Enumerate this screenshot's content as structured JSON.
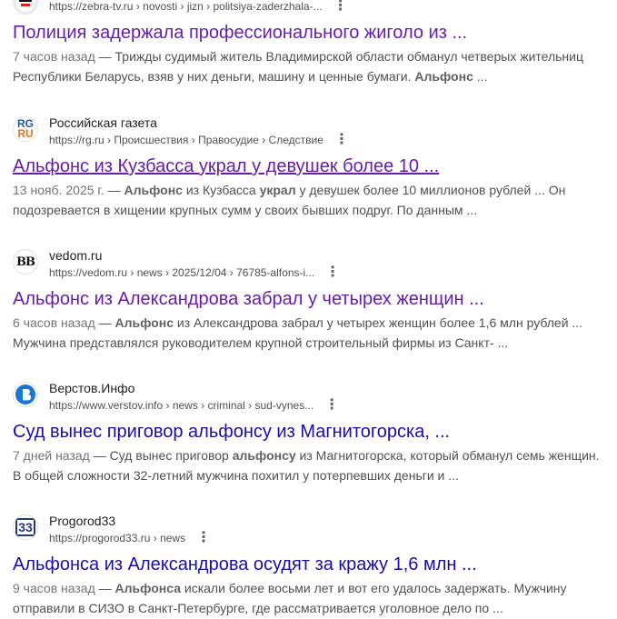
{
  "results": [
    {
      "site_name": "",
      "url": "https://zebra-tv.ru › novosti › jizn › politsiya-zaderzhala-...",
      "title": "Полиция задержала профессионального жиголо из ...",
      "date": "7 часов назад",
      "snippet_parts": [
        {
          "t": " — Трижды судимый житель Владимирской области обманул четверых жительниц Республики Беларусь, взяв у них деньги, машину и ценные бумаги. ",
          "b": false
        },
        {
          "t": "Альфонс",
          "b": true
        },
        {
          "t": " ...",
          "b": false
        }
      ],
      "favicon": "zebra-tv-logo"
    },
    {
      "site_name": "Российская газета",
      "url": "https://rg.ru › Происшествия › Правосудие › Следствие",
      "title": "Альфонс из Кузбасса украл у девушек более 10 ...",
      "date": "13 нояб. 2025 г.",
      "snippet_parts": [
        {
          "t": " — ",
          "b": false
        },
        {
          "t": "Альфонс",
          "b": true
        },
        {
          "t": " из Кузбасса ",
          "b": false
        },
        {
          "t": "украл",
          "b": true
        },
        {
          "t": " у девушек более 10 миллионов рублей ... Он подозревается в хищении крупных сумм у своих бывших подруг. По данным ...",
          "b": false
        }
      ],
      "favicon": "rg-logo"
    },
    {
      "site_name": "vedom.ru",
      "url": "https://vedom.ru › news › 2025/12/04 › 76785-alfons-i...",
      "title": "Альфонс из Александрова забрал у четырех женщин ...",
      "date": "6 часов назад",
      "snippet_parts": [
        {
          "t": " — ",
          "b": false
        },
        {
          "t": "Альфонс",
          "b": true
        },
        {
          "t": " из Александрова забрал у четырех женщин более 1,6 млн рублей ... Мужчина представлялся руководителем крупной строительный фирмы из Санкт- ...",
          "b": false
        }
      ],
      "favicon": "vedom-logo"
    },
    {
      "site_name": "Верстов.Инфо",
      "url": "https://www.verstov.info › news › criminal › sud-vynes...",
      "title": "Суд вынес приговор альфонсу из Магнитогорска, ...",
      "date": "7 дней назад",
      "snippet_parts": [
        {
          "t": " — Суд вынес приговор ",
          "b": false
        },
        {
          "t": "альфонсу",
          "b": true
        },
        {
          "t": " из Магнитогорска, который обманул семь женщин. В общей сложности 32-летний мужчина похитил у потерпевших деньги и ...",
          "b": false
        }
      ],
      "favicon": "verstov-logo"
    },
    {
      "site_name": "Progorod33",
      "url": "https://progorod33.ru › news",
      "title": "Альфонса из Александрова осудят за кражу 1,6 млн ...",
      "date": "9 часов назад",
      "snippet_parts": [
        {
          "t": " — ",
          "b": false
        },
        {
          "t": "Альфонса",
          "b": true
        },
        {
          "t": " искали более восьми лет и вот его удалось задержать. Мужчину отправили в СИЗО в Санкт-Петербурге, где рассматривается уголовное дело по ...",
          "b": false
        }
      ],
      "favicon": "progorod33-logo"
    }
  ],
  "logo_text": {
    "rg_top": "RG",
    "rg_bottom": "RU",
    "vedom": "BB",
    "progorod": "33"
  },
  "colors": {
    "link": "#1a0dab",
    "visited": "#681da8",
    "text": "#4d5156",
    "rg_blue": "#1f5aa8",
    "rg_orange": "#e8701a",
    "verstov_blue": "#1976d2"
  }
}
